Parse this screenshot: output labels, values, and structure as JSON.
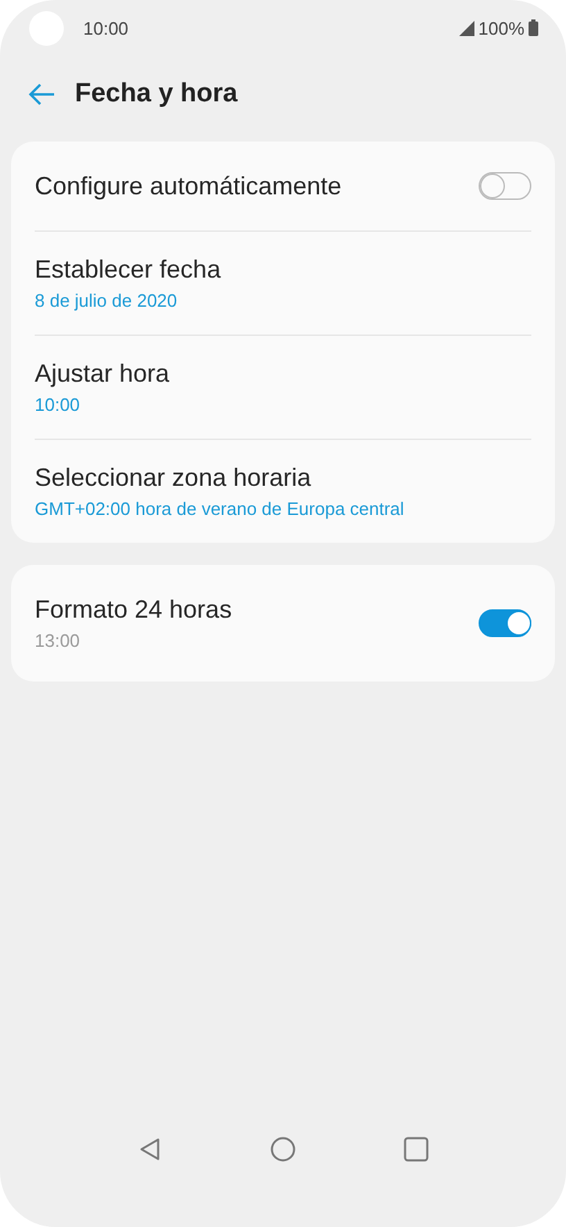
{
  "status_bar": {
    "time": "10:00",
    "battery": "100%"
  },
  "header": {
    "title": "Fecha y hora"
  },
  "groups": [
    {
      "rows": [
        {
          "kind": "toggle",
          "title": "Configure automáticamente",
          "on": false
        },
        {
          "kind": "value",
          "title": "Establecer fecha",
          "value": "8 de julio de 2020"
        },
        {
          "kind": "value",
          "title": "Ajustar hora",
          "value": "10:00"
        },
        {
          "kind": "value",
          "title": "Seleccionar zona horaria",
          "value": "GMT+02:00 hora de verano de Europa central"
        }
      ]
    },
    {
      "rows": [
        {
          "kind": "toggle",
          "title": "Formato 24 horas",
          "summary": "13:00",
          "on": true
        }
      ]
    }
  ]
}
